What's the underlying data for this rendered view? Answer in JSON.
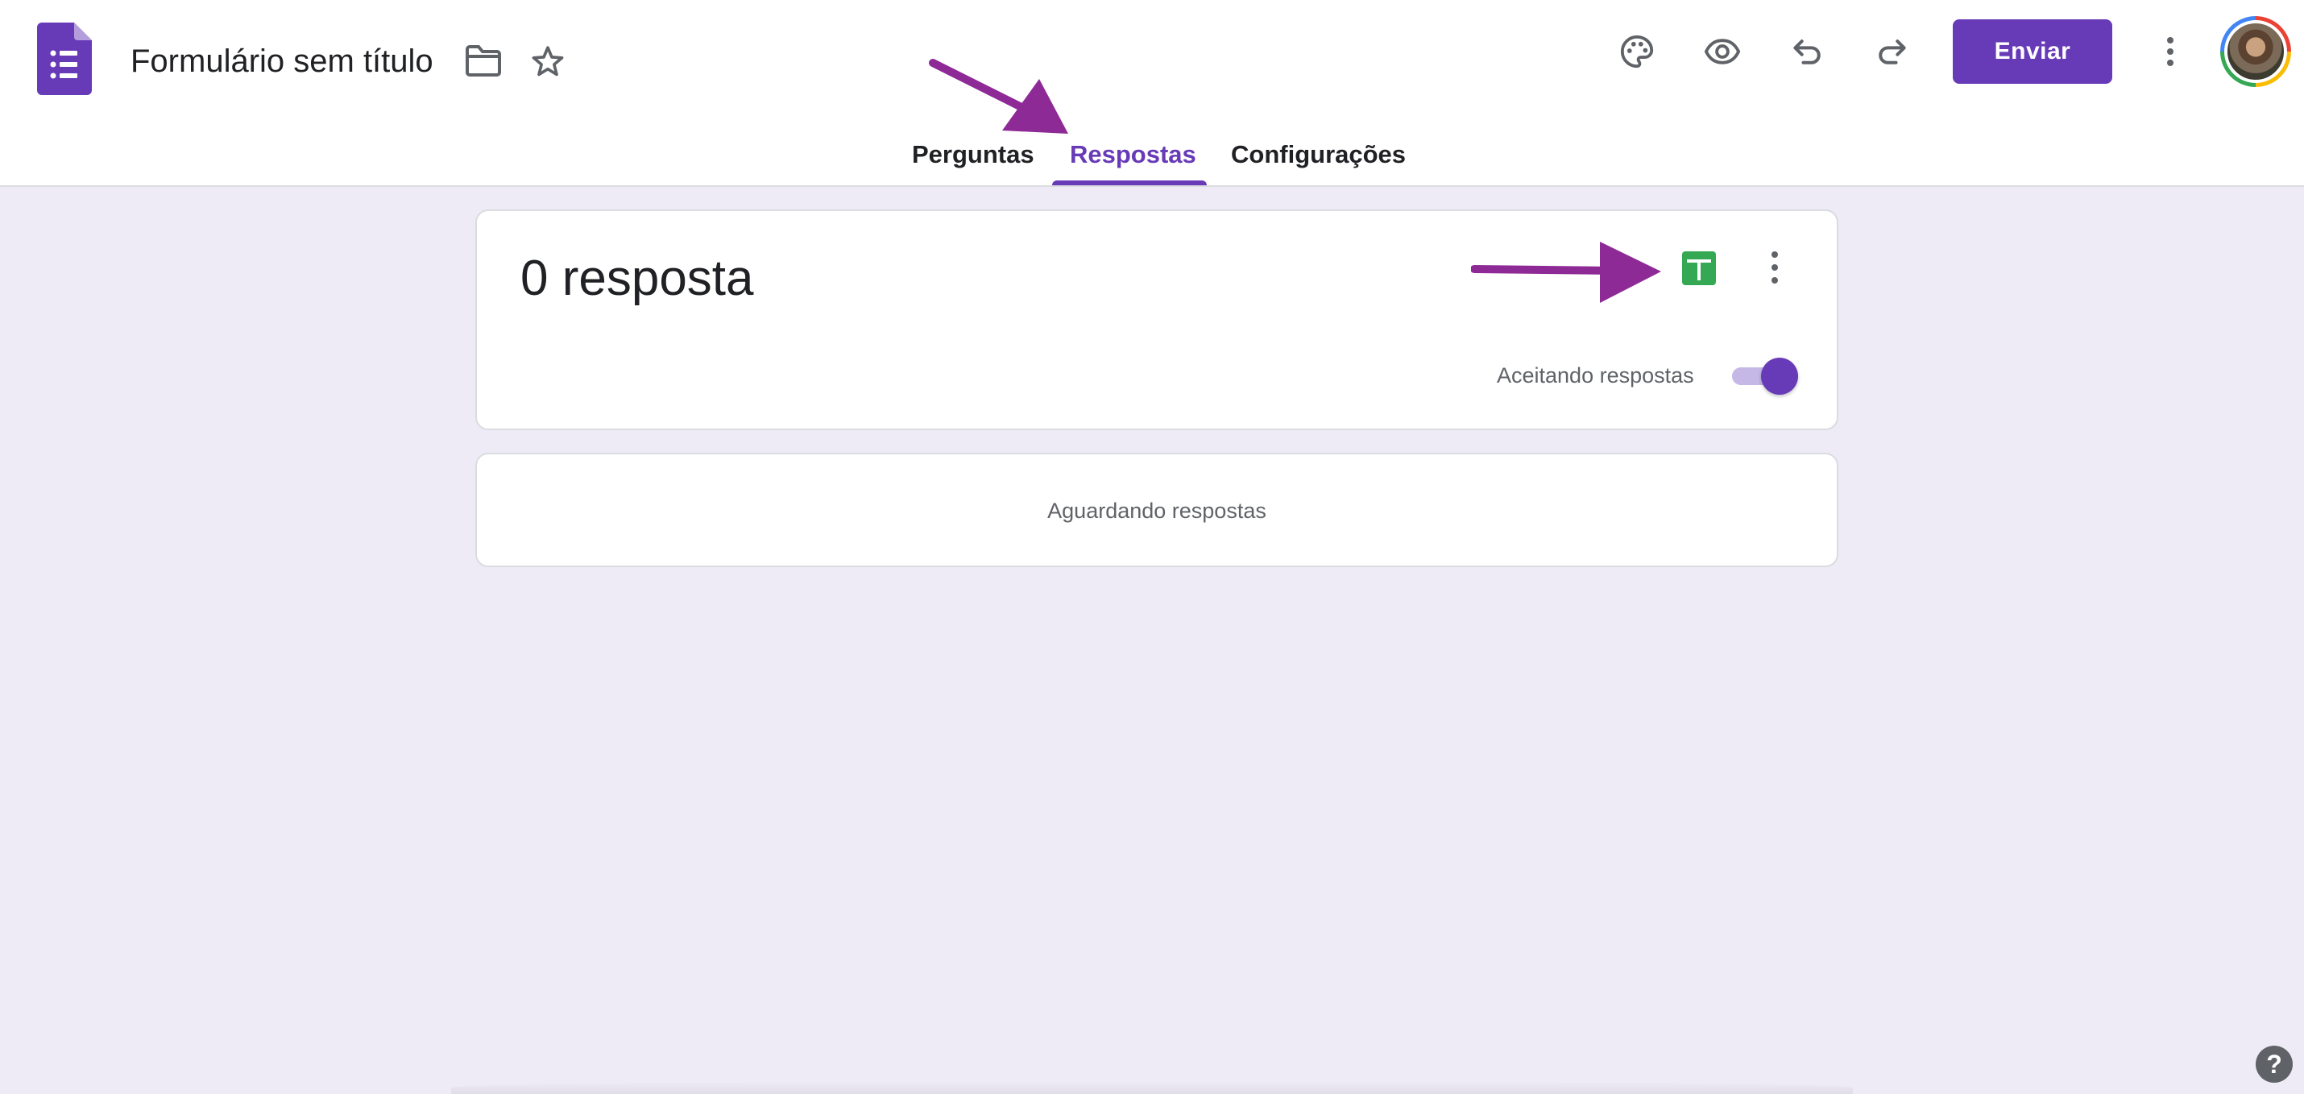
{
  "app": {
    "doc_title": "Formulário sem título",
    "send_label": "Enviar"
  },
  "tabs": [
    {
      "label": "Perguntas",
      "active": false
    },
    {
      "label": "Respostas",
      "active": true
    },
    {
      "label": "Configurações",
      "active": false
    }
  ],
  "responses": {
    "count_text": "0 resposta",
    "accepting_label": "Aceitando respostas",
    "accepting": true,
    "waiting_text": "Aguardando respostas"
  },
  "help": {
    "label": "?"
  },
  "icons": {
    "forms_logo": "google-forms-icon",
    "folder": "folder-icon",
    "star": "star-icon",
    "palette": "palette-icon",
    "preview": "eye-icon",
    "undo": "undo-icon",
    "redo": "redo-icon",
    "more": "more-vert-icon",
    "sheets": "google-sheets-icon"
  },
  "colors": {
    "accent": "#673ab7",
    "background": "#eeebf6",
    "sheets_green": "#34a853",
    "annotation_arrow": "#8e2a96"
  }
}
